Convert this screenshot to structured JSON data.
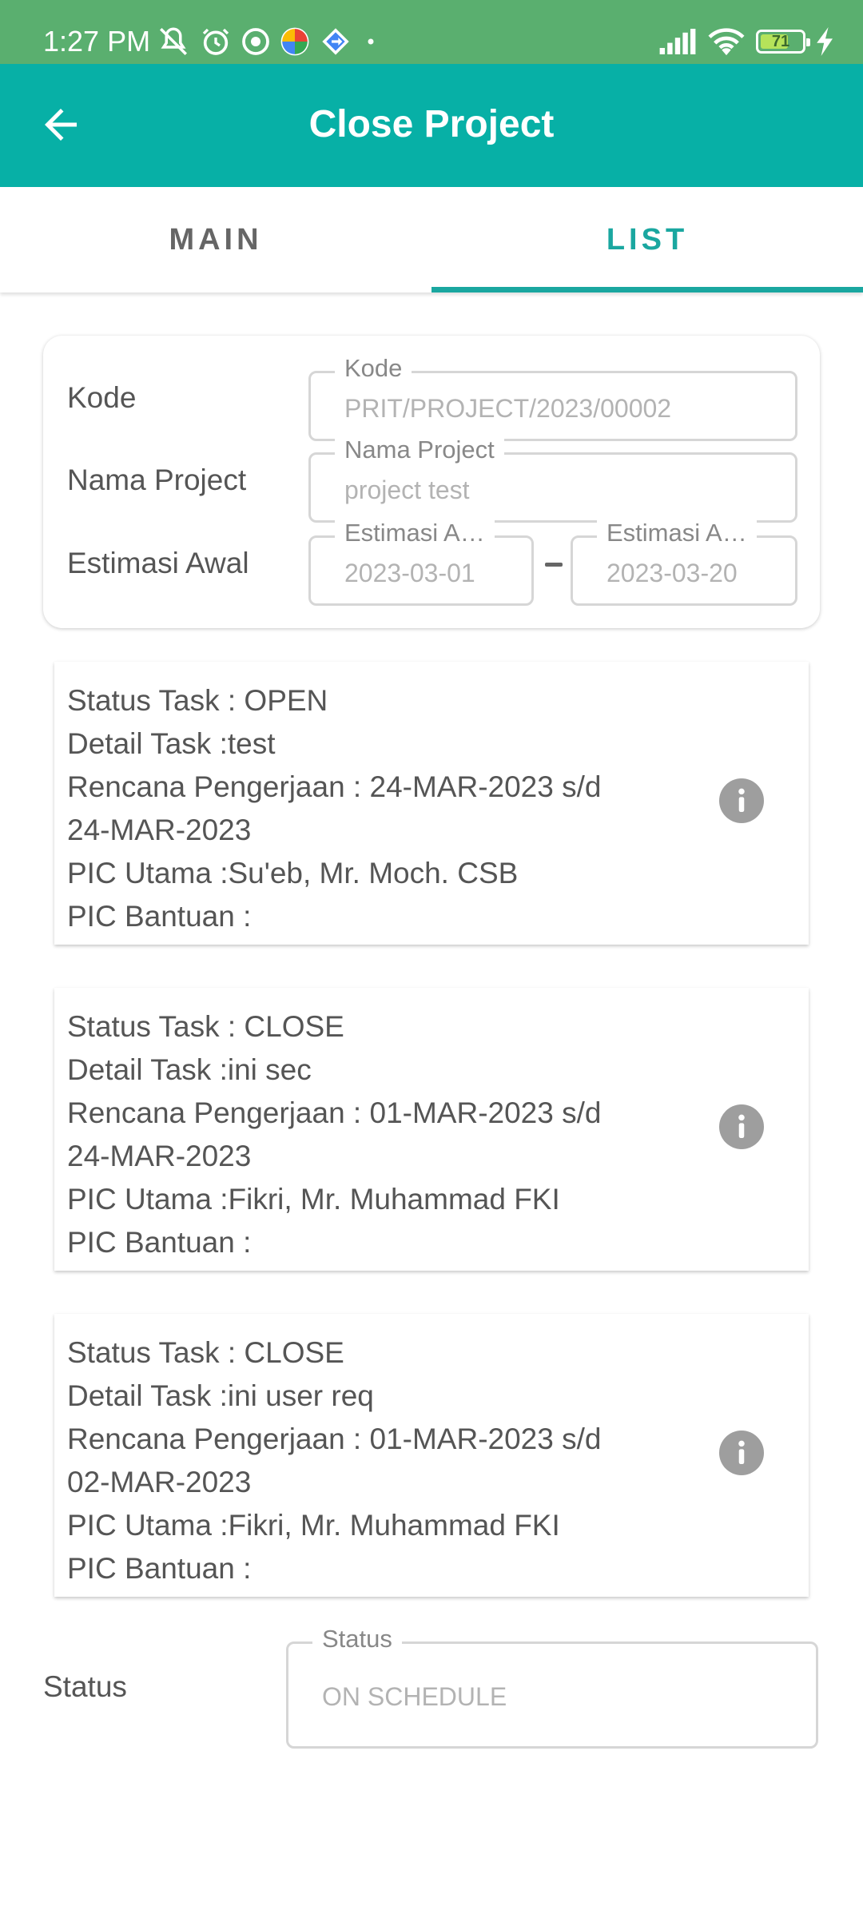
{
  "status_bar": {
    "time": "1:27 PM",
    "battery_level": "71",
    "icons": [
      "muted-icon",
      "alarm-icon",
      "whatsapp-icon",
      "pinwheel-icon",
      "maps-icon",
      "dot-icon",
      "signal-icon",
      "wifi-icon",
      "battery-icon",
      "charging-icon"
    ]
  },
  "app_bar": {
    "title": "Close Project",
    "back_icon": "arrow-left-icon"
  },
  "tabs": [
    {
      "label": "MAIN",
      "selected": false
    },
    {
      "label": "LIST",
      "selected": true
    }
  ],
  "colors": {
    "status_bar": "#5aaf6f",
    "app_bar": "#07b0a6",
    "accent": "#1aa7a0"
  },
  "header": {
    "kode": {
      "label": "Kode",
      "field_label": "Kode",
      "value": "PRIT/PROJECT/2023/00002"
    },
    "nama_project": {
      "label": "Nama Project",
      "field_label": "Nama Project",
      "value": "project test"
    },
    "estimasi_awal": {
      "label": "Estimasi Awal",
      "start": {
        "field_label": "Estimasi A…",
        "value": "2023-03-01"
      },
      "end": {
        "field_label": "Estimasi A…",
        "value": "2023-03-20"
      }
    }
  },
  "tasks": [
    {
      "status": "Status Task : OPEN",
      "detail": "Detail Task :test",
      "rencana_1": "Rencana Pengerjaan : 24-MAR-2023 s/d",
      "rencana_2": "24-MAR-2023",
      "pic_utama": "PIC Utama :Su'eb, Mr. Moch. CSB",
      "pic_bantuan": "PIC Bantuan :",
      "info_icon": "info-icon"
    },
    {
      "status": "Status Task : CLOSE",
      "detail": "Detail Task :ini sec",
      "rencana_1": "Rencana Pengerjaan : 01-MAR-2023 s/d",
      "rencana_2": "24-MAR-2023",
      "pic_utama": "PIC Utama :Fikri, Mr. Muhammad FKI",
      "pic_bantuan": "PIC Bantuan :",
      "info_icon": "info-icon"
    },
    {
      "status": "Status Task : CLOSE",
      "detail": "Detail Task :ini user req",
      "rencana_1": "Rencana Pengerjaan : 01-MAR-2023 s/d",
      "rencana_2": "02-MAR-2023",
      "pic_utama": "PIC Utama :Fikri, Mr. Muhammad FKI",
      "pic_bantuan": "PIC Bantuan :",
      "info_icon": "info-icon"
    }
  ],
  "status_row": {
    "label": "Status",
    "field_label": "Status",
    "value": "ON SCHEDULE"
  }
}
